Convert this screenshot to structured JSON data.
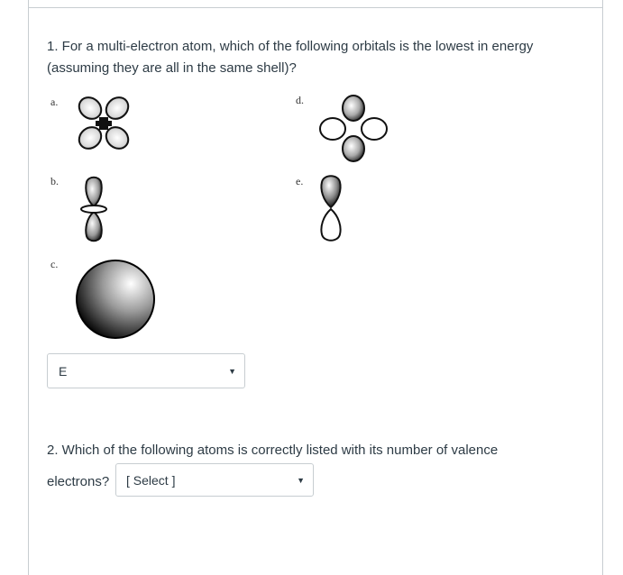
{
  "question1": {
    "text": "1. For a multi-electron atom, which of the following orbitals is the lowest in energy (assuming they are all in the same shell)?",
    "options": [
      {
        "label": "a.",
        "orbital": "d-cloverleaf-orbital"
      },
      {
        "label": "b.",
        "orbital": "dz2-orbital"
      },
      {
        "label": "c.",
        "orbital": "s-orbital"
      },
      {
        "label": "d.",
        "orbital": "d-cloverleaf-orbital-shaded"
      },
      {
        "label": "e.",
        "orbital": "p-orbital"
      }
    ],
    "answer_select": {
      "value": "E",
      "caret": "▼"
    }
  },
  "question2": {
    "text": "2. Which of the following atoms is correctly listed with its number of valence",
    "text_tail": "electrons?",
    "answer_select": {
      "value": "[ Select ]",
      "caret": "▼"
    }
  }
}
